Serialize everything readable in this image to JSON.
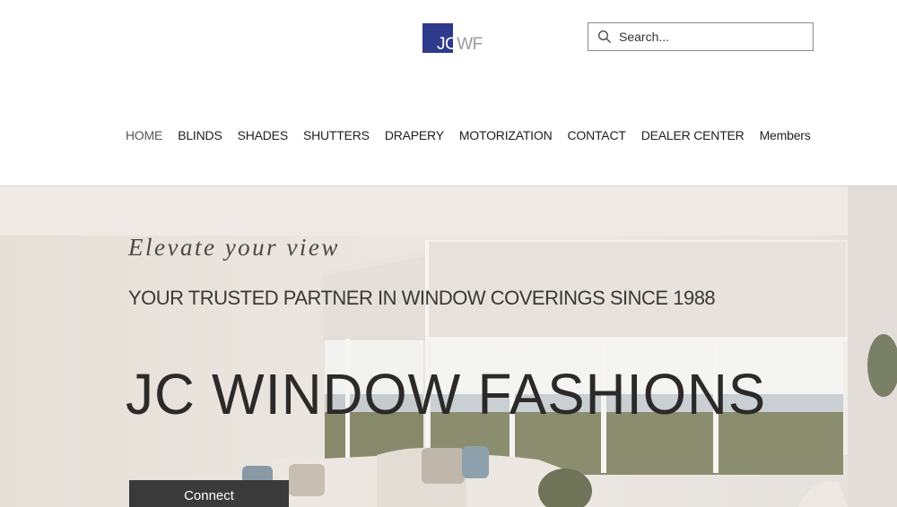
{
  "logo": {
    "initial": "JC",
    "rest": "WF"
  },
  "search": {
    "placeholder": "Search..."
  },
  "nav": {
    "items": [
      "HOME",
      "BLINDS",
      "SHADES",
      "SHUTTERS",
      "DRAPERY",
      "MOTORIZATION",
      "CONTACT",
      "DEALER CENTER",
      "Members"
    ],
    "active": "HOME"
  },
  "hero": {
    "tagline": "Elevate your view",
    "subtitle": "YOUR TRUSTED PARTNER IN WINDOW COVERINGS SINCE 1988",
    "brand": "JC WINDOW FASHIONS",
    "cta": "Connect"
  },
  "colors": {
    "logo_blue": "#2e3a8c",
    "button": "#3a3a3a",
    "text": "#1e1e1e"
  }
}
